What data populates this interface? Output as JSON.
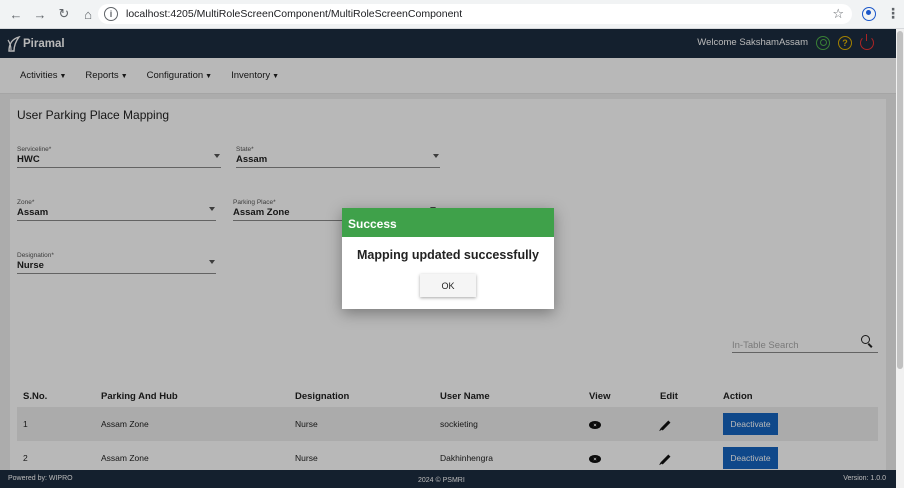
{
  "browser": {
    "url": "localhost:4205/MultiRoleScreenComponent/MultiRoleScreenComponent"
  },
  "header": {
    "brand": "Piramal",
    "welcome": "Welcome SakshamAssam",
    "help_symbol": "?"
  },
  "menu": [
    "Activities",
    "Reports",
    "Configuration",
    "Inventory"
  ],
  "page": {
    "title": "User Parking Place Mapping",
    "fields": {
      "serviceline": {
        "label": "Serviceline*",
        "value": "HWC"
      },
      "state": {
        "label": "State*",
        "value": "Assam"
      },
      "zone": {
        "label": "Zone*",
        "value": "Assam"
      },
      "parking_place": {
        "label": "Parking Place*",
        "value": "Assam Zone"
      },
      "designation": {
        "label": "Designation*",
        "value": "Nurse"
      }
    },
    "search": {
      "placeholder": "In-Table Search"
    }
  },
  "table": {
    "headers": [
      "S.No.",
      "Parking And Hub",
      "Designation",
      "User Name",
      "View",
      "Edit",
      "Action"
    ],
    "rows": [
      {
        "sno": "1",
        "parking": "Assam Zone",
        "designation": "Nurse",
        "user": "sockieting",
        "action": "Deactivate"
      },
      {
        "sno": "2",
        "parking": "Assam Zone",
        "designation": "Nurse",
        "user": "Dakhinhengra",
        "action": "Deactivate"
      }
    ]
  },
  "footer": {
    "left": "Powered by: WIPRO",
    "mid": "2024 © PSMRI",
    "right": "Version: 1.0.0"
  },
  "dialog": {
    "title": "Success",
    "message": "Mapping updated successfully",
    "ok": "OK"
  },
  "colors": {
    "topbar": "#1d2d40",
    "success": "#3fa14a",
    "primary_button": "#1565c0"
  }
}
